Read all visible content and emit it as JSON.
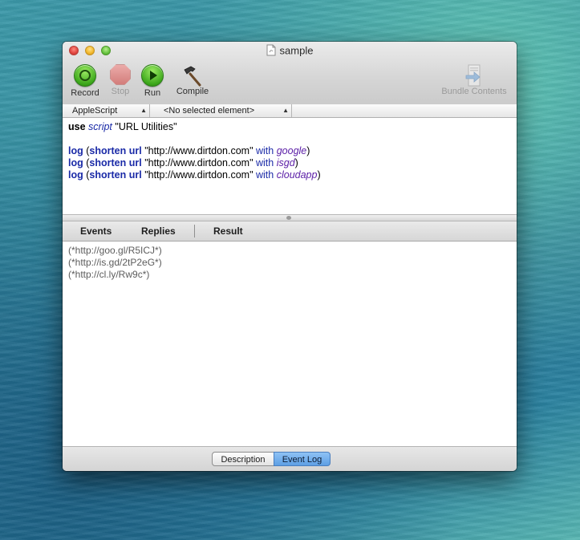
{
  "window": {
    "title": "sample"
  },
  "toolbar": {
    "record": "Record",
    "stop": "Stop",
    "run": "Run",
    "compile": "Compile",
    "bundle": "Bundle Contents"
  },
  "navbar": {
    "language": "AppleScript",
    "element": "<No selected element>"
  },
  "editor": {
    "line1": {
      "kw": "use",
      "type": "script",
      "str": "\"URL Utilities\""
    },
    "lines": [
      {
        "cmd": "log",
        "open": "(",
        "handler": "shorten url",
        "url": "\"http://www.dirtdon.com\"",
        "with": "with",
        "param": "google",
        "close": ")"
      },
      {
        "cmd": "log",
        "open": "(",
        "handler": "shorten url",
        "url": "\"http://www.dirtdon.com\"",
        "with": "with",
        "param": "isgd",
        "close": ")"
      },
      {
        "cmd": "log",
        "open": "(",
        "handler": "shorten url",
        "url": "\"http://www.dirtdon.com\"",
        "with": "with",
        "param": "cloudapp",
        "close": ")"
      }
    ]
  },
  "tabs": {
    "events": "Events",
    "replies": "Replies",
    "result": "Result"
  },
  "log": {
    "entries": [
      "(*http://goo.gl/R5ICJ*)",
      "(*http://is.gd/2tP2eG*)",
      "(*http://cl.ly/Rw9c*)"
    ]
  },
  "footer": {
    "description": "Description",
    "event_log": "Event Log"
  },
  "colors": {
    "keyword_blue": "#1a2aa7",
    "param_purple": "#5a1da6",
    "selected_segment": "#5d9fe4"
  }
}
